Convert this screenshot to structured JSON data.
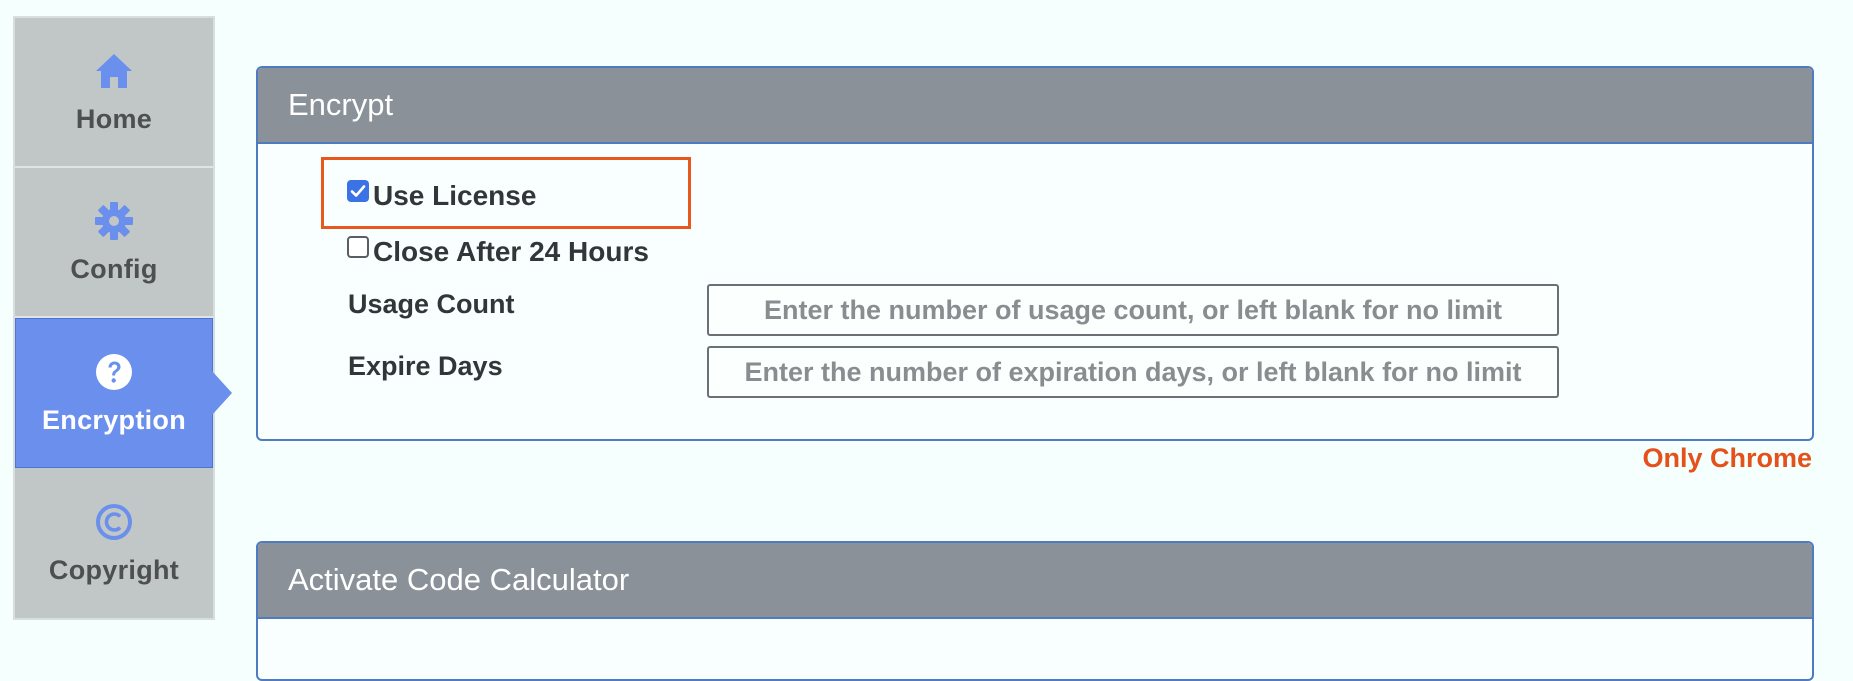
{
  "sidebar": {
    "items": [
      {
        "label": "Home",
        "icon": "home-icon",
        "active": false
      },
      {
        "label": "Config",
        "icon": "gear-icon",
        "active": false
      },
      {
        "label": "Encryption",
        "icon": "question-circle-icon",
        "active": true
      },
      {
        "label": "Copyright",
        "icon": "copyright-icon",
        "active": false
      }
    ]
  },
  "encrypt_panel": {
    "title": "Encrypt",
    "use_license": {
      "label": "Use License",
      "checked": true
    },
    "close_after": {
      "label": "Close After 24 Hours",
      "checked": false
    },
    "usage_count": {
      "label": "Usage Count",
      "value": "",
      "placeholder": "Enter the number of usage count, or left blank for no limit"
    },
    "expire_days": {
      "label": "Expire Days",
      "value": "",
      "placeholder": "Enter the number of expiration days, or left blank for no limit"
    },
    "note": "Only Chrome"
  },
  "activate_panel": {
    "title": "Activate Code Calculator"
  },
  "colors": {
    "accent": "#6a8fec",
    "highlight": "#e8581c",
    "header": "#8a9198",
    "warning": "#e4511a"
  }
}
